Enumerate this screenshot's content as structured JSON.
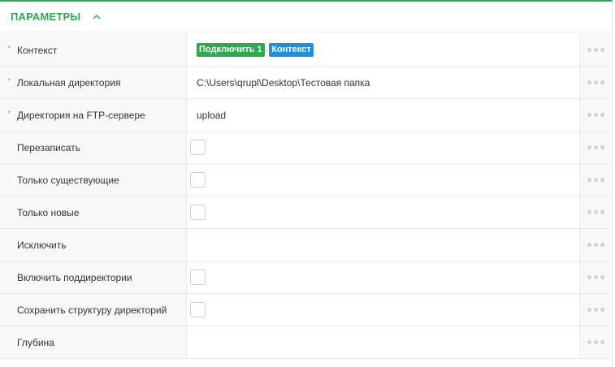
{
  "header": {
    "title": "ПАРАМЕТРЫ",
    "chevron_icon": "chevron-up-icon"
  },
  "colors": {
    "accent": "#2fa94e",
    "tag_blue": "#1a8fe3"
  },
  "rows": [
    {
      "label": "Контекст",
      "required": true,
      "type": "tags",
      "tags": [
        "Подключить 1",
        "Контекст"
      ],
      "sep": "-"
    },
    {
      "label": "Локальная директория",
      "required": true,
      "type": "text",
      "value": "C:\\Users\\qrupl\\Desktop\\Тестовая папка"
    },
    {
      "label": "Директория на FTP-сервере",
      "required": true,
      "type": "text",
      "value": "upload"
    },
    {
      "label": "Перезаписать",
      "required": false,
      "type": "checkbox",
      "checked": false
    },
    {
      "label": "Только существующие",
      "required": false,
      "type": "checkbox",
      "checked": false
    },
    {
      "label": "Только новые",
      "required": false,
      "type": "checkbox",
      "checked": false
    },
    {
      "label": "Исключить",
      "required": false,
      "type": "text",
      "value": ""
    },
    {
      "label": "Включить поддиректории",
      "required": false,
      "type": "checkbox",
      "checked": false
    },
    {
      "label": "Сохранить структуру директорий",
      "required": false,
      "type": "checkbox",
      "checked": false
    },
    {
      "label": "Глубина",
      "required": false,
      "type": "text",
      "value": ""
    }
  ],
  "required_marker": "*",
  "actions_icon": "more-horizontal-icon"
}
